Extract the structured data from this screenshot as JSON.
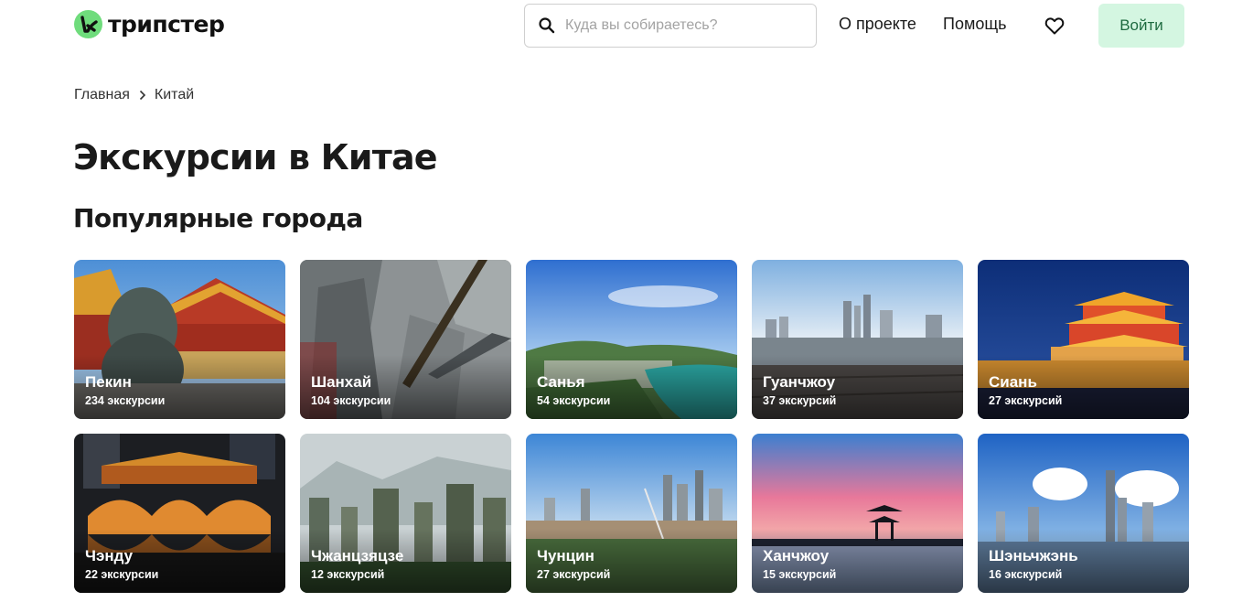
{
  "header": {
    "logo_text": "трипстер",
    "search_placeholder": "Куда вы собираетесь?",
    "nav_about": "О проекте",
    "nav_help": "Помощь",
    "login_label": "Войти",
    "icons": [
      "logo-icon",
      "search-icon",
      "heart-icon"
    ],
    "colors": {
      "brand_green": "#6fdc7c",
      "login_bg": "#d4f6e1",
      "login_text": "#1e6b40"
    }
  },
  "breadcrumb": {
    "home": "Главная",
    "current": "Китай"
  },
  "page_title": "Экскурсии в Китае",
  "section_title": "Популярные города",
  "cities": [
    {
      "name": "Пекин",
      "count": "234 экскурсии"
    },
    {
      "name": "Шанхай",
      "count": "104 экскурсии"
    },
    {
      "name": "Санья",
      "count": "54 экскурсии"
    },
    {
      "name": "Гуанчжоу",
      "count": "37 экскурсий"
    },
    {
      "name": "Сиань",
      "count": "27 экскурсий"
    },
    {
      "name": "Чэнду",
      "count": "22 экскурсии"
    },
    {
      "name": "Чжанцзяцзе",
      "count": "12 экскурсий"
    },
    {
      "name": "Чунцин",
      "count": "27 экскурсий"
    },
    {
      "name": "Ханчжоу",
      "count": "15 экскурсий"
    },
    {
      "name": "Шэньчжэнь",
      "count": "16 экскурсий"
    }
  ]
}
